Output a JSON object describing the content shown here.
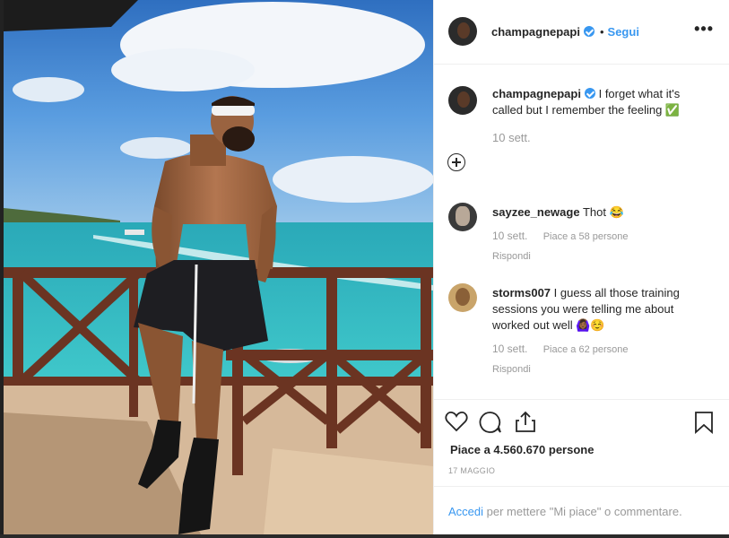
{
  "post": {
    "username": "champagnepapi",
    "follow_label": "Segui",
    "separator": "•",
    "more_label": "•••"
  },
  "caption": {
    "username": "champagnepapi",
    "text": "I forget what it's called but I remember the feeling ✅",
    "time": "10 sett."
  },
  "comments": [
    {
      "username": "sayzee_newage",
      "text": "Thot 😂",
      "time": "10 sett.",
      "likes": "Piace a 58 persone",
      "reply": "Rispondi"
    },
    {
      "username": "storms007",
      "text": "I guess all those training sessions you were telling me about worked out well 🙆🏾‍♀️☺️",
      "time": "10 sett.",
      "likes": "Piace a 62 persone",
      "reply": "Rispondi"
    }
  ],
  "stats": {
    "likes": "Piace a 4.560.670 persone",
    "date": "17 MAGGIO"
  },
  "footer": {
    "login_label": "Accedi",
    "rest_text": " per mettere \"Mi piace\" o commentare."
  },
  "icons": [
    "verified-icon",
    "more-icon",
    "add-comment-icon",
    "heart-icon",
    "comment-icon",
    "share-icon",
    "bookmark-icon"
  ],
  "colors": {
    "link": "#3897f0",
    "text": "#262626",
    "muted": "#999999",
    "border": "#efefef"
  }
}
